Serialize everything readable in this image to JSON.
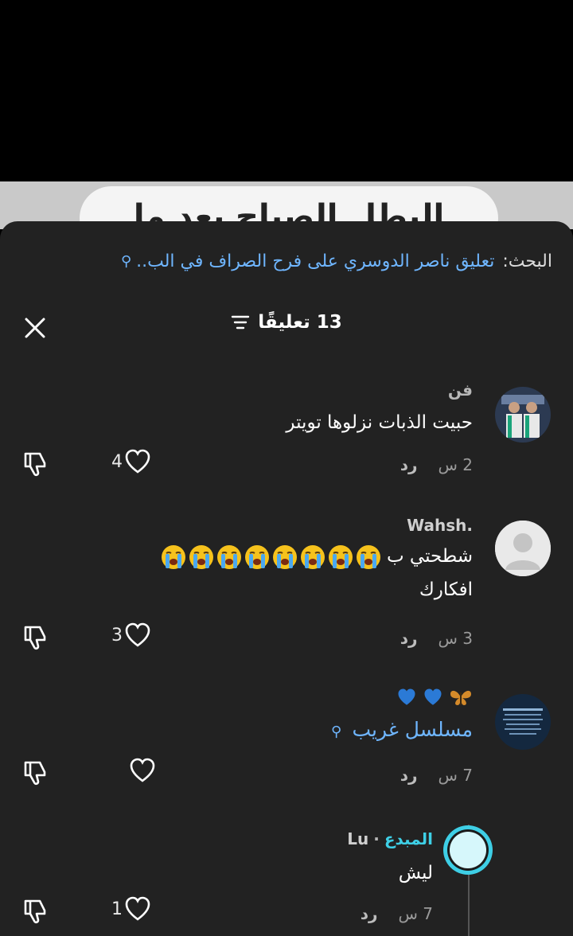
{
  "video": {
    "overlay_text": "البطل الصباح يعد ما البطلة"
  },
  "search": {
    "label": "البحث:",
    "term": "تعليق ناصر الدوسري على فرح الصراف في الب.."
  },
  "header": {
    "title": "13 تعليقًا"
  },
  "comments": [
    {
      "user": "فن",
      "text": "حبيت الذبات نزلوها تويتر",
      "time": "2 س",
      "reply": "رد",
      "likes": "4"
    },
    {
      "user": "Wahsh.",
      "text_prefix": "شطحتي ب",
      "text_line2": "افكارك",
      "time": "3 س",
      "reply": "رد",
      "likes": "3"
    },
    {
      "user_emojis": [
        "butterfly-icon",
        "blue-heart-icon",
        "blue-heart-icon"
      ],
      "hashtag": "مسلسل غريب",
      "time": "7 س",
      "reply": "رد",
      "likes": ""
    },
    {
      "user": "Lu",
      "creator_badge": "المبدع",
      "separator": "·",
      "text": "ليش",
      "time": "7 س",
      "reply": "رد",
      "likes": "1"
    }
  ],
  "colors": {
    "sheet": "#222222",
    "link": "#6fb6ff",
    "muted": "#9a9a9a"
  }
}
